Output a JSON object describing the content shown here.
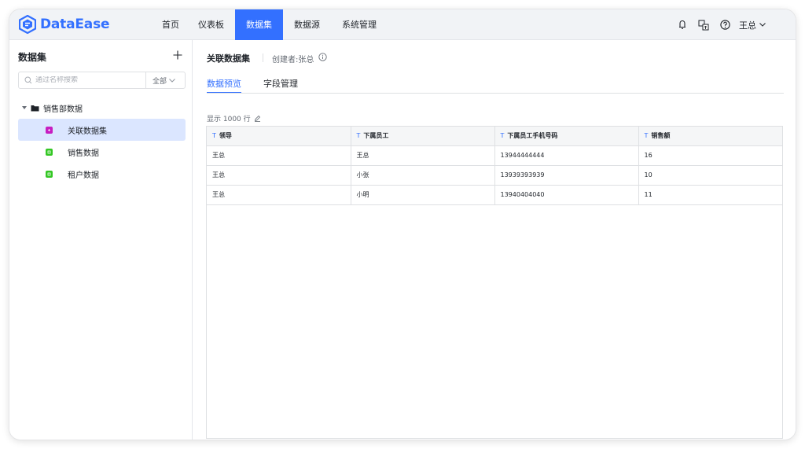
{
  "app": {
    "logo_text": "DataEase"
  },
  "nav": {
    "items": [
      {
        "label": "首页",
        "active": false
      },
      {
        "label": "仪表板",
        "active": false
      },
      {
        "label": "数据集",
        "active": true
      },
      {
        "label": "数据源",
        "active": false
      },
      {
        "label": "系统管理",
        "active": false
      }
    ]
  },
  "header": {
    "user_name": "王总"
  },
  "sidebar": {
    "title": "数据集",
    "search_placeholder": "通过名称搜索",
    "filter_label": "全部",
    "folder": {
      "label": "销售部数据"
    },
    "items": [
      {
        "label": "关联数据集",
        "active": true,
        "icon_color": "#c71ec1"
      },
      {
        "label": "销售数据",
        "active": false,
        "icon_color": "#34c724"
      },
      {
        "label": "租户数据",
        "active": false,
        "icon_color": "#34c724"
      }
    ]
  },
  "main": {
    "title": "关联数据集",
    "creator": "创建者:张总",
    "tabs": [
      {
        "label": "数据预览",
        "active": true
      },
      {
        "label": "字段管理",
        "active": false
      }
    ],
    "rows_info": "显示 1000 行"
  },
  "table": {
    "type_icon": "T",
    "columns": [
      "领导",
      "下属员工",
      "下属员工手机号码",
      "销售额"
    ],
    "rows": [
      [
        "王总",
        "王总",
        "13944444444",
        "16"
      ],
      [
        "王总",
        "小张",
        "13939393939",
        "10"
      ],
      [
        "王总",
        "小明",
        "13940404040",
        "11"
      ]
    ]
  },
  "colors": {
    "accent": "#3370ff",
    "active_bg": "#dbe6ff"
  }
}
